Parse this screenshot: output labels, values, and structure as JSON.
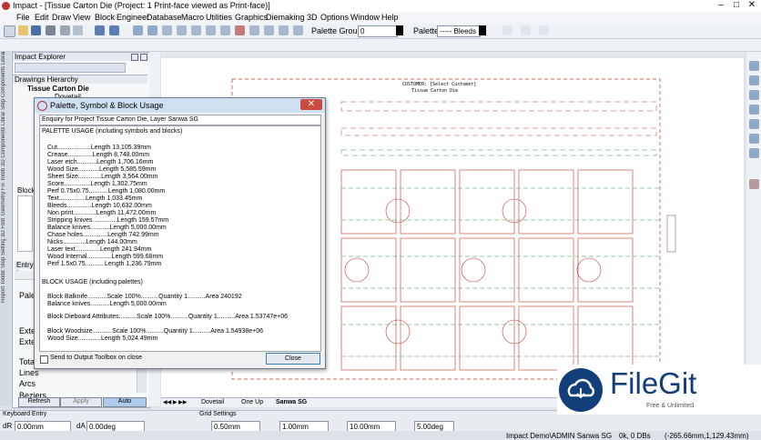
{
  "window": {
    "title": "Impact - [Tissue Carton Die (Project: 1 Print-face viewed as  Print-face)]"
  },
  "menus": [
    "File",
    "Edit",
    "Draw",
    "View",
    "Block",
    "Engineer",
    "Database",
    "Macro",
    "Utilities",
    "Graphics",
    "Diemaking",
    "3D",
    "Options",
    "Window",
    "Help"
  ],
  "toolbar": {
    "palette_group_label": "Palette Group:",
    "palette_group_value": "0",
    "palette_label": "Palette:",
    "palette_value": "----- Bleeds"
  },
  "left_tabs": [
    "Step Components Library",
    "3D Components Library",
    "Geometry Fix Toolbox",
    "3D Fold",
    "Step Settings",
    "Report Toolbox"
  ],
  "explorer": {
    "title": "Impact Explorer",
    "hierarchy_header": "Drawings Hierarchy",
    "tree": [
      "Tissue Carton Die",
      "Dovetail"
    ],
    "block_label": "Block",
    "entry_label": "Entry In",
    "fields": [
      "Palette",
      "Exter",
      "Exter",
      "Total",
      "Lines",
      "Arcs",
      "Beziers"
    ],
    "buttons": {
      "refresh": "Refresh",
      "apply": "Apply",
      "auto": "Auto"
    }
  },
  "canvas": {
    "drawing_title_line1": "CUSTOMER: [Select Customer]",
    "drawing_title_line2": "Tissue Carton Die"
  },
  "bottom_tabs": [
    "Dovetail",
    "One Up",
    "Sanwa SG"
  ],
  "status": {
    "keyboard_entry_label": "Keyboard Entry",
    "dr_label": "dR",
    "dr_value": "0.00mm",
    "da_label": "dA",
    "da_value": "0.00deg",
    "grid_label": "Grid Settings",
    "grid_values": [
      "0.50mm",
      "1.00mm",
      "10.00mm",
      "5.00deg"
    ],
    "status_text": "Impact Demo\\ADMIN  Sanwa SG",
    "ok_label": "0k, 0 DBs",
    "coord_text": "(-265.66mm,1,129.43mm)"
  },
  "dialog": {
    "title": "Palette, Symbol & Block Usage",
    "enquiry": "Enquiry for Project Tissue Carton Die, Layer Sanwa SG",
    "lines": [
      "PALETTE USAGE (including symbols and blocks)",
      "",
      "Cut...................Length 13,105.39mm",
      "Crease..............Length 8,748.00mm",
      "Laser etch...........Length 1,706.16mm",
      "Wood Size............Length 5,585.59mm",
      "Sheet Size.............Length 3,564.00mm",
      "Score...............Length 1,302.75mm",
      "Perf 0.75x0.75...........Length 1,080.00mm",
      "Text...............Length 1,033.45mm",
      "Bleeds..............Length 10,632.00mm",
      "Non print.............Length 11,472.00mm",
      "Stripping knives..............Length 159.57mm",
      "Balance knives...........Length 5,000.00mm",
      "Chase holes..............Length 742.99mm",
      "Nicks.............Length 144.00mm",
      "Laser text..............Length 241.94mm",
      "Wood Internal..............Length 599.68mm",
      "Perf 1.5x0.75...........Length 1,236.79mm",
      "",
      "",
      "BLOCK USAGE (including palettes)",
      "",
      "Block Balknife...........Scale 100%..........Quantity 1..........Area 240192",
      "Balance knives...........Length 5,000.00mm",
      "",
      "Block Dieboard Attributes..........Scale 100%..........Quantity 1..........Area 1.53747e+06",
      "",
      "Block Woodsize...........Scale 100%..........Quantity 1..........Area 1.54938e+06",
      "Wood Size.............Length 5,024.49mm"
    ],
    "send_label": "Send to Output Toolbox on close",
    "close_label": "Close"
  },
  "watermark": {
    "brand": "FileGit",
    "tagline": "Free & Unlimited"
  },
  "colors": {
    "cut": "#c0392b",
    "crease": "#2e9b3a",
    "accent": "#123e7a"
  }
}
